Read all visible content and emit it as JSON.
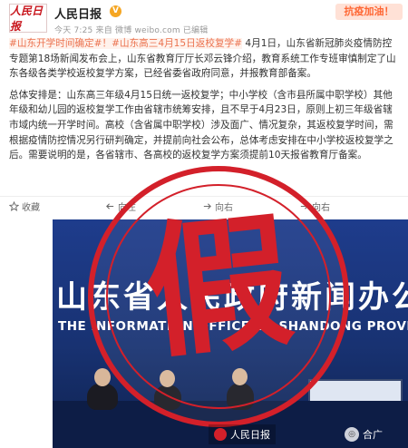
{
  "account": {
    "avatar_text": "人民日报",
    "name": "人民日报",
    "verified_glyph": "V",
    "meta": "今天 7:25 来自 微博 weibo.com    已编辑"
  },
  "promo_label": "抗疫加油！",
  "post": {
    "tags": "#山东开学时间确定#！#山东高三4月15日返校复学#",
    "p1_rest": " 4月1日，山东省新冠肺炎疫情防控专题第18场新闻发布会上，山东省教育厅厅长邓云锋介绍，教育系统工作专班审慎制定了山东各级各类学校返校复学方案，已经省委省政府同意，并报教育部备案。",
    "p2": "总体安排是：山东高三年级4月15日统一返校复学；中小学校（含市县所属中职学校）其他年级和幼儿园的返校复学工作由省辖市统筹安排，且不早于4月23日，原则上初三年级省辖市域内统一开学时间。高校（含省属中职学校）涉及面广、情况复杂，其返校复学时间，需根据疫情防控情况另行研判确定，并提前向社会公布，总体考虑安排在中小学校返校复学之后。需要说明的是，各省辖市、各高校的返校复学方案须提前10天报省教育厅备案。"
  },
  "actions": {
    "collect": "收藏",
    "forward": "向左",
    "comment": "向右",
    "like": "向右"
  },
  "photo": {
    "banner_cn": "山东省人民政府新闻办公室",
    "banner_en": "THE INFORMATION OFFICE OF SHANDONG PROVINCE PEOPLE'S GOVERNMENT",
    "stamp_char": "假",
    "watermark": "人民日报",
    "watermark2": "合广"
  },
  "colors": {
    "stamp_red": "#d3202a",
    "tag_orange": "#eb7350",
    "banner_blue": "#1e3c8c"
  }
}
